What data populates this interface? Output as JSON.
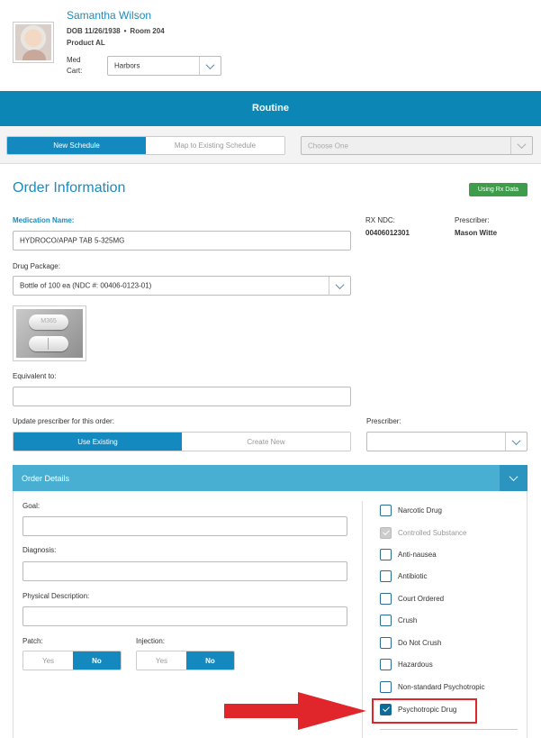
{
  "patient": {
    "name": "Samantha Wilson",
    "dob": "DOB 11/26/1938",
    "room": "Room 204",
    "product": "Product AL",
    "med_cart_label": "Med Cart:",
    "med_cart_value": "Harbors"
  },
  "band": {
    "title": "Routine"
  },
  "schedule": {
    "new_schedule": "New Schedule",
    "map_existing": "Map to Existing Schedule",
    "choose_placeholder": "Choose One"
  },
  "order": {
    "title": "Order Information",
    "rx_badge": "Using Rx Data",
    "medication_label": "Medication Name:",
    "medication_value": "HYDROCO/APAP TAB 5-325MG",
    "rx_ndc_label": "RX NDC:",
    "rx_ndc_value": "00406012301",
    "prescriber_label": "Prescriber:",
    "prescriber_value": "Mason Witte",
    "drug_package_label": "Drug Package:",
    "drug_package_value": "Bottle of 100 ea (NDC #: 00406-0123-01)",
    "pill_imprint": "M365",
    "equivalent_label": "Equivalent to:",
    "equivalent_value": "",
    "update_prescriber_label": "Update prescriber for this order:",
    "use_existing": "Use Existing",
    "create_new": "Create New",
    "prescriber2_label": "Prescriber:",
    "prescriber2_value": ""
  },
  "details": {
    "title": "Order Details",
    "goal_label": "Goal:",
    "diagnosis_label": "Diagnosis:",
    "physical_label": "Physical Description:",
    "patch_label": "Patch:",
    "injection_label": "Injection:",
    "yes": "Yes",
    "no": "No",
    "checkboxes": [
      {
        "label": "Narcotic Drug",
        "checked": false,
        "disabled": false
      },
      {
        "label": "Controlled Substance",
        "checked": true,
        "disabled": true
      },
      {
        "label": "Anti-nausea",
        "checked": false,
        "disabled": false
      },
      {
        "label": "Antibiotic",
        "checked": false,
        "disabled": false
      },
      {
        "label": "Court Ordered",
        "checked": false,
        "disabled": false
      },
      {
        "label": "Crush",
        "checked": false,
        "disabled": false
      },
      {
        "label": "Do Not Crush",
        "checked": false,
        "disabled": false
      },
      {
        "label": "Hazardous",
        "checked": false,
        "disabled": false
      },
      {
        "label": "Non-standard Psychotropic",
        "checked": false,
        "disabled": false
      },
      {
        "label": "Psychotropic Drug",
        "checked": true,
        "disabled": false
      }
    ]
  },
  "colors": {
    "accent": "#0c86b5",
    "highlight": "#e0262a",
    "badge": "#3f9c4a"
  }
}
